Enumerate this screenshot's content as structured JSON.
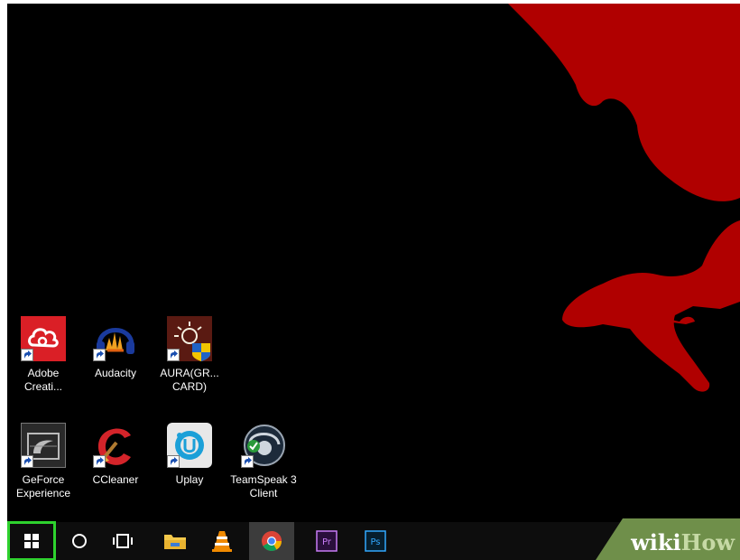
{
  "desktop": {
    "icons": [
      {
        "name": "Adobe Creative Cloud",
        "label": "Adobe\nCreati..."
      },
      {
        "name": "Audacity",
        "label": "Audacity"
      },
      {
        "name": "AURA",
        "label": "AURA(GR...\nCARD)"
      },
      {
        "name": "GeForce Experience",
        "label": "GeForce\nExperience"
      },
      {
        "name": "CCleaner",
        "label": "CCleaner"
      },
      {
        "name": "Uplay",
        "label": "Uplay"
      },
      {
        "name": "TeamSpeak 3 Client",
        "label": "TeamSpeak 3\nClient"
      }
    ]
  },
  "taskbar": {
    "items": [
      {
        "name": "start",
        "icon": "windows-logo-icon"
      },
      {
        "name": "search",
        "icon": "cortana-circle-icon"
      },
      {
        "name": "task-view",
        "icon": "task-view-icon"
      },
      {
        "name": "file-explorer",
        "icon": "folder-icon"
      },
      {
        "name": "vlc",
        "icon": "vlc-cone-icon"
      },
      {
        "name": "chrome",
        "icon": "chrome-icon"
      },
      {
        "name": "premiere",
        "icon": "premiere-icon",
        "text": "Pr"
      },
      {
        "name": "photoshop",
        "icon": "photoshop-icon",
        "text": "Ps"
      }
    ],
    "accent": "#2ed22e"
  },
  "watermark": {
    "wiki": "wiki",
    "how": "How"
  },
  "colors": {
    "wallpaper_bg": "#000000",
    "handprint": "#b00000",
    "watermark_bg": "#6f8f4a"
  }
}
